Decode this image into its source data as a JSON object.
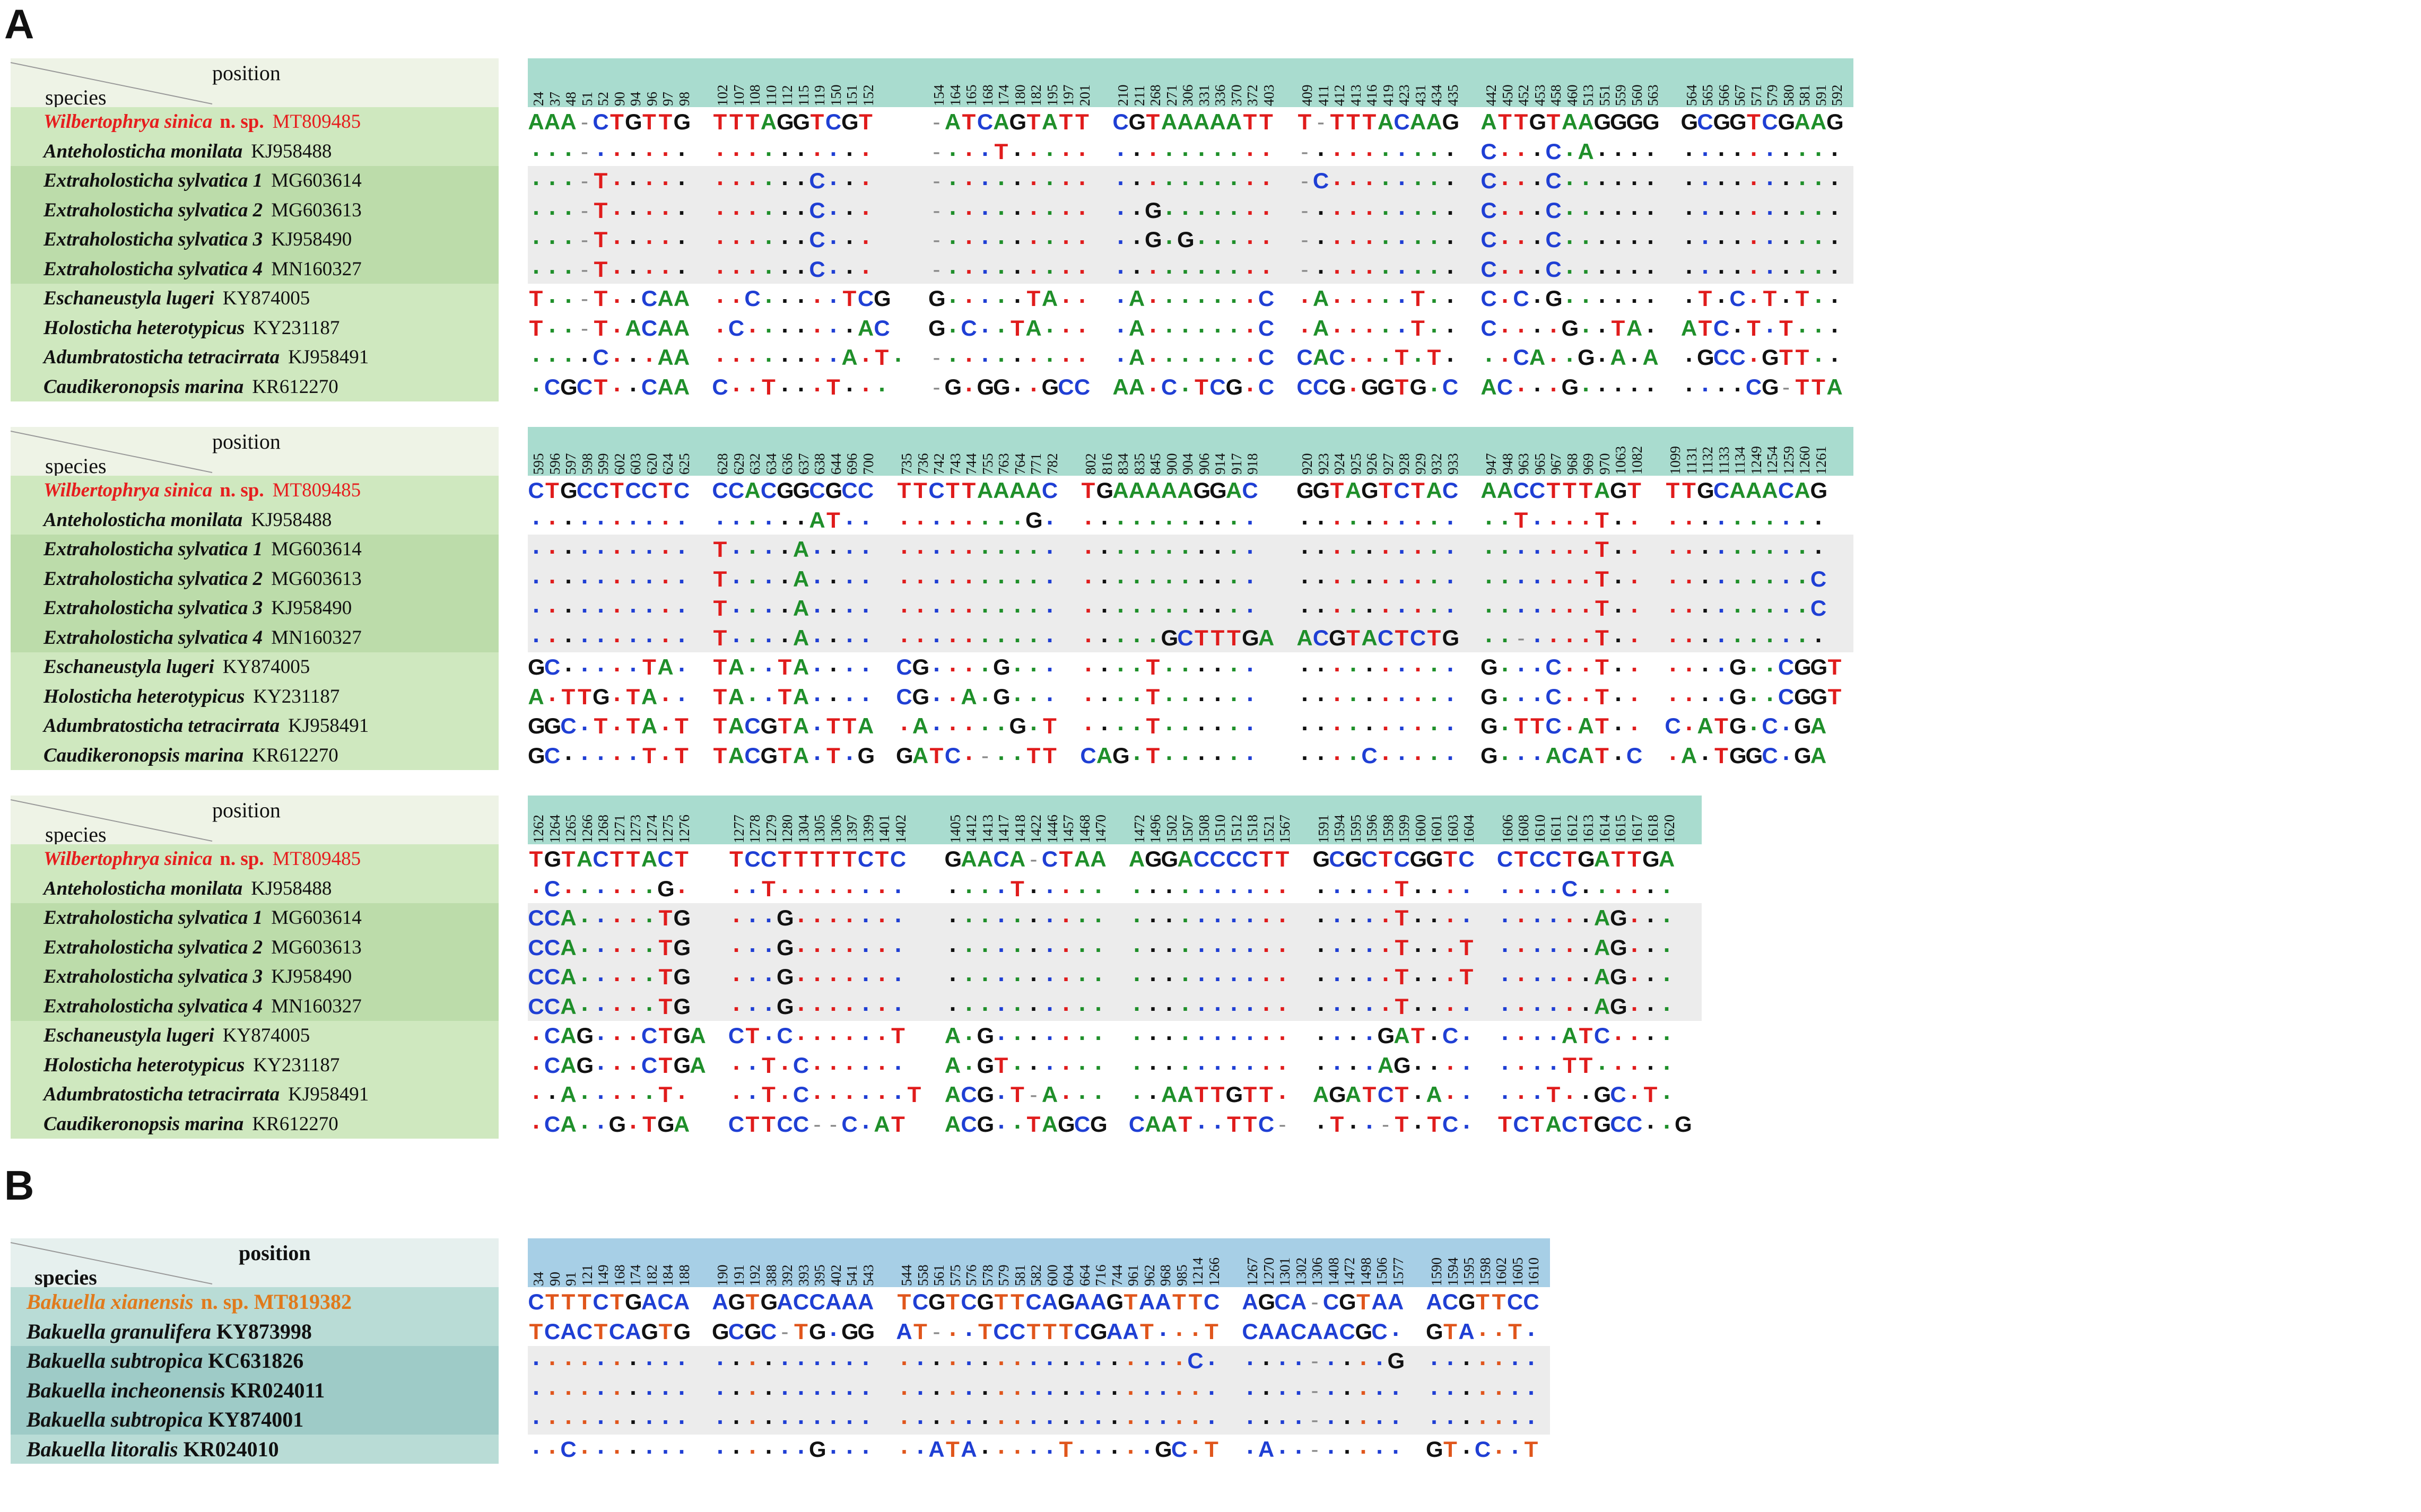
{
  "panels": [
    {
      "letter": "A",
      "header": {
        "position": "position",
        "species": "species"
      },
      "species": [
        {
          "name": "Wilbertophrya sinica",
          "nsp": "n. sp.",
          "acc": "MT809485",
          "new": true
        },
        {
          "name": "Anteholosticha monilata",
          "acc": "KJ958488"
        },
        {
          "name": "Extraholosticha sylvatica 1",
          "acc": "MG603614"
        },
        {
          "name": "Extraholosticha sylvatica 2",
          "acc": "MG603613"
        },
        {
          "name": "Extraholosticha sylvatica 3",
          "acc": "KJ958490"
        },
        {
          "name": "Extraholosticha sylvatica 4",
          "acc": "MN160327"
        },
        {
          "name": "Eschaneustyla lugeri",
          "acc": "KY874005"
        },
        {
          "name": "Holosticha heterotypicus",
          "acc": "KY231187"
        },
        {
          "name": "Adumbratosticha tetracirrata",
          "acc": "KJ958491"
        },
        {
          "name": "Caudikeronopsis marina",
          "acc": "KR612270"
        }
      ],
      "blocks": [
        {
          "groups": [
            {
              "pos": [
                "24",
                "37",
                "48",
                "51",
                "52",
                "90",
                "94",
                "96",
                "97",
                "98"
              ],
              "rows": [
                "AAA-CTGTTG",
                "...-......",
                "...-T.....",
                "...-T.....",
                "...-T.....",
                "...-T.....",
                "T..-T..CAA",
                "T..-T.ACAA",
                "....C...AA",
                ".CGCT..CAA"
              ]
            },
            {
              "pos": [
                "102",
                "107",
                "108",
                "110",
                "112",
                "115",
                "119",
                "150",
                "151",
                "152"
              ],
              "rows": [
                "TTTAGGTCGT",
                "..........",
                "......C...",
                "......C...",
                "......C...",
                "......C...",
                "..C.....TCG",
                ".C.......AC",
                "........A.T.",
                "C..T...T..."
              ]
            },
            {
              "pos": [
                "154",
                "164",
                "165",
                "168",
                "174",
                "180",
                "182",
                "195",
                "197",
                "201"
              ],
              "rows": [
                "-ATCAGTATT",
                "-...T.....",
                "-.........",
                "-.........",
                "-.........",
                "-.........",
                "G.....TA..",
                "G.C..TA...",
                "-.........",
                "-G.GG..GCC"
              ]
            },
            {
              "pos": [
                "210",
                "211",
                "268",
                "271",
                "306",
                "331",
                "336",
                "370",
                "372",
                "403"
              ],
              "rows": [
                "CGTAAAAATT",
                "..........",
                "..........",
                "..G.......",
                "..G.G.....",
                "..........",
                ".A.......C",
                ".A.......C",
                ".A.......C",
                "AA.C.TCG.C"
              ]
            },
            {
              "pos": [
                "409",
                "411",
                "412",
                "413",
                "416",
                "419",
                "423",
                "431",
                "434",
                "435"
              ],
              "rows": [
                "T-TTTACAAG",
                "-.........",
                "-C........",
                "-.........",
                "-.........",
                "-.........",
                ".A.....T..",
                ".A.....T..",
                "CAC...T.T.",
                "CCG.GGTG.C"
              ]
            },
            {
              "pos": [
                "442",
                "450",
                "452",
                "453",
                "458",
                "460",
                "513",
                "551",
                "559",
                "560",
                "563"
              ],
              "rows": [
                "ATTGTAAGGGG",
                "C...C.A....",
                "C...C......",
                "C...C......",
                "C...C......",
                "C...C......",
                "C.C.G......",
                "C....G..TA.",
                "..CA..G.A.A",
                "AC...G....."
              ]
            },
            {
              "pos": [
                "564",
                "565",
                "566",
                "567",
                "571",
                "579",
                "580",
                "581",
                "591",
                "592"
              ],
              "rows": [
                "GCGGTCGAAG",
                "..........",
                "..........",
                "..........",
                "..........",
                "..........",
                ".T.C.T.T..",
                "ATC.T.T...",
                ".GCC.GTT..",
                "....CG-TTA"
              ]
            }
          ]
        },
        {
          "groups": [
            {
              "pos": [
                "595",
                "596",
                "597",
                "598",
                "599",
                "602",
                "603",
                "620",
                "624",
                "625"
              ],
              "rows": [
                "CTGCCTCCTC",
                "..........",
                "..........",
                "..........",
                "..........",
                "..........",
                "GC.....TA.",
                "A.TTG.TA..",
                "GGC.T.TA.T",
                "GC.....T.T"
              ]
            },
            {
              "pos": [
                "628",
                "629",
                "632",
                "634",
                "636",
                "637",
                "638",
                "644",
                "696",
                "700"
              ],
              "rows": [
                "CCACGGCGCC",
                "......AT..",
                "T....A....",
                "T....A....",
                "T....A....",
                "T....A....",
                "TA..TA....",
                "TA..TA....",
                "TACGTA.TTA",
                "TACGTA.T.G"
              ]
            },
            {
              "pos": [
                "735",
                "736",
                "742",
                "743",
                "744",
                "755",
                "763",
                "764",
                "771",
                "782"
              ],
              "rows": [
                "TTCTTAAAAC",
                "........G.",
                "..........",
                "..........",
                "..........",
                "..........",
                "CG....G...",
                "CG..A.G...",
                ".A.....G.T",
                "GATC.-..TT"
              ]
            },
            {
              "pos": [
                "802",
                "816",
                "834",
                "835",
                "845",
                "900",
                "904",
                "906",
                "914",
                "917",
                "918"
              ],
              "rows": [
                "TGAAAAAGGAC",
                "...........",
                "...........",
                "...........",
                "...........",
                ".....GCTTTGA",
                "....T......",
                "....T......",
                "....T......",
                "CAG.T......"
              ]
            },
            {
              "pos": [
                "920",
                "923",
                "924",
                "925",
                "926",
                "927",
                "928",
                "929",
                "932",
                "933"
              ],
              "rows": [
                "GGTAGTCTAC",
                "..........",
                "..........",
                "..........",
                "..........",
                "ACGTACTCTG",
                "..........",
                "..........",
                "..........",
                "....C....."
              ]
            },
            {
              "pos": [
                "947",
                "948",
                "963",
                "965",
                "967",
                "968",
                "969",
                "970",
                "1063",
                "1082"
              ],
              "rows": [
                "AACCTTTAGT",
                "..T....T..",
                ".......T..",
                ".......T..",
                ".......T..",
                "..-....T..",
                "G...C..T..",
                "G...C..T..",
                "G.TTC.AT..",
                "G...ACAT.C"
              ]
            },
            {
              "pos": [
                "1099",
                "1131",
                "1132",
                "1133",
                "1134",
                "1249",
                "1254",
                "1259",
                "1260",
                "1261"
              ],
              "rows": [
                "TTGCAAACAG",
                "..........",
                "..........",
                ".........C",
                ".........C",
                "..........",
                "....G..CGGT",
                "....G..CGGT",
                "C.ATG.C.GA",
                ".A.TGGC.GA"
              ]
            }
          ]
        },
        {
          "groups": [
            {
              "pos": [
                "1262",
                "1264",
                "1265",
                "1266",
                "1268",
                "1271",
                "1273",
                "1274",
                "1275",
                "1276"
              ],
              "rows": [
                "TGTACTTACT",
                ".C......G.",
                "CCA.....TG",
                "CCA.....TG",
                "CCA.....TG",
                "CCA.....TG",
                ".CAG...CTGA",
                ".CAG...CTGA",
                "..A.....T.",
                ".CA..G.TGA"
              ]
            },
            {
              "pos": [
                "1277",
                "1278",
                "1279",
                "1280",
                "1304",
                "1305",
                "1306",
                "1397",
                "1399",
                "1401",
                "1402"
              ],
              "rows": [
                "TCCTTTTTCTC",
                "..T........",
                "...G.......",
                "...G.......",
                "...G.......",
                "...G.......",
                "CT.C......T",
                "..T.C......",
                "..T.C......T",
                "CTTCC--C.AT"
              ]
            },
            {
              "pos": [
                "1405",
                "1412",
                "1413",
                "1417",
                "1418",
                "1422",
                "1446",
                "1457",
                "1468",
                "1470"
              ],
              "rows": [
                "GAACA-CTAA",
                "....T.....",
                "..........",
                "..........",
                "..........",
                "..........",
                "A.G.......",
                "A.GT......",
                "ACG.T-A...",
                "ACG..TAGCG"
              ]
            },
            {
              "pos": [
                "1472",
                "1496",
                "1502",
                "1507",
                "1508",
                "1510",
                "1512",
                "1518",
                "1521",
                "1567"
              ],
              "rows": [
                "AGGACCCCTT",
                "..........",
                "..........",
                "..........",
                "..........",
                "..........",
                "..........",
                "..........",
                "..AATTGTT.",
                "CAAT..TTC-"
              ]
            },
            {
              "pos": [
                "1591",
                "1594",
                "1595",
                "1596",
                "1598",
                "1599",
                "1600",
                "1601",
                "1603",
                "1604"
              ],
              "rows": [
                "GCGCTCGGTC",
                ".....T....",
                ".....T....",
                ".....T...T",
                ".....T...T",
                ".....T....",
                "....GAT.C.",
                "....AG....",
                "AGATCT.A..",
                ".T..-T.TC."
              ]
            },
            {
              "pos": [
                "1606",
                "1608",
                "1610",
                "1611",
                "1612",
                "1613",
                "1614",
                "1615",
                "1617",
                "1618",
                "1620"
              ],
              "rows": [
                "CTCCTGATTGA",
                "....C......",
                "......AG...",
                "......AG...",
                "......AG...",
                "......AG...",
                "....ATC....",
                "....TT.....",
                "...T..GC.T.",
                "TCTACTGCC..G"
              ]
            }
          ]
        }
      ]
    },
    {
      "letter": "B",
      "header": {
        "position": "position",
        "species": "species"
      },
      "species": [
        {
          "name": "Bakuella xianensis",
          "nsp": "n. sp.",
          "acc": "MT819382",
          "new": true
        },
        {
          "name": "Bakuella granulifera",
          "acc": "KY873998"
        },
        {
          "name": "Bakuella subtropica",
          "acc": "KC631826"
        },
        {
          "name": "Bakuella incheonensis",
          "acc": "KR024011"
        },
        {
          "name": "Bakuella subtropica",
          "acc": "KY874001"
        },
        {
          "name": "Bakuella litoralis",
          "acc": "KR024010"
        }
      ],
      "blocks": [
        {
          "groups": [
            {
              "pos": [
                "34",
                "90",
                "91",
                "121",
                "149",
                "168",
                "174",
                "182",
                "184",
                "188"
              ],
              "rows": [
                "CTTTCTGACA",
                "TCACTCAGTG",
                "..........",
                "..........",
                "..........",
                "..C......."
              ]
            },
            {
              "pos": [
                "190",
                "191",
                "192",
                "388",
                "392",
                "393",
                "395",
                "402",
                "541",
                "543"
              ],
              "rows": [
                "AGTGACCAAA",
                "GCGC-TG.GG",
                "..........",
                "..........",
                "..........",
                "......G..."
              ]
            },
            {
              "pos": [
                "544",
                "558",
                "561",
                "575",
                "576",
                "578",
                "579",
                "581",
                "582",
                "600",
                "604",
                "664",
                "716",
                "744",
                "961",
                "962",
                "968",
                "985",
                "1214",
                "1266"
              ],
              "rows": [
                "TCGTCGTTCAGAAGTAATTC",
                "AT-..TCCTTTCGAAT...T",
                "..................C.",
                "....................",
                "....................",
                "..ATA.....T.....GC.T"
              ]
            },
            {
              "pos": [
                "1267",
                "1270",
                "1301",
                "1302",
                "1306",
                "1408",
                "1472",
                "1498",
                "1506",
                "1577"
              ],
              "rows": [
                "AGCA-CGTAA",
                "CAACAACGC.",
                "....-....G",
                "....-.....",
                "....-.....",
                ".A..-....."
              ]
            },
            {
              "pos": [
                "1590",
                "1594",
                "1595",
                "1598",
                "1602",
                "1605",
                "1610"
              ],
              "rows": [
                "ACGTTCC",
                "GTA..T.",
                ".......",
                ".......",
                ".......",
                "GT.C..T"
              ]
            }
          ]
        }
      ]
    }
  ]
}
